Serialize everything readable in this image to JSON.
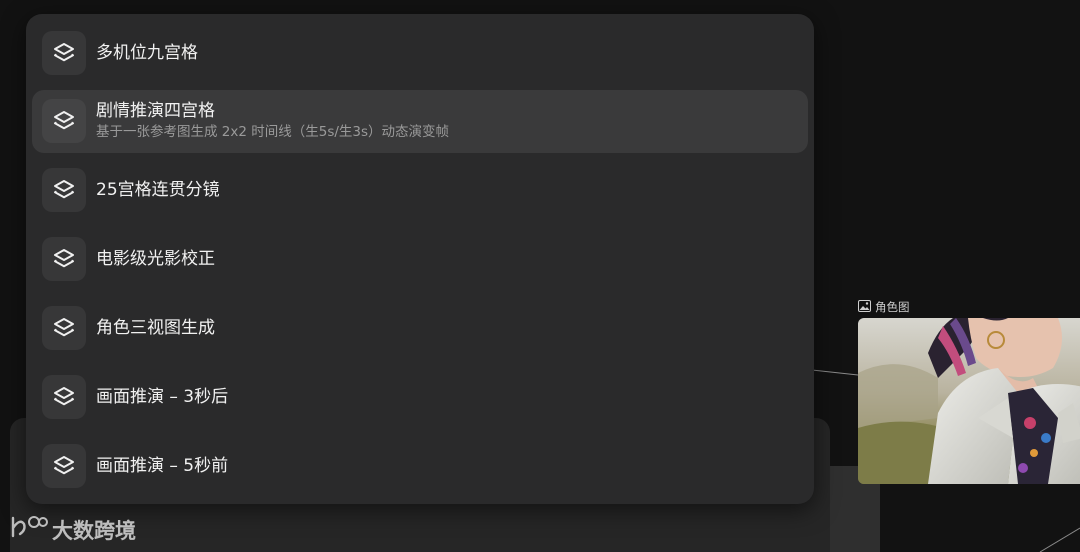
{
  "menu": {
    "items": [
      {
        "title": "多机位九宫格",
        "description": "",
        "icon": "layers-icon"
      },
      {
        "title": "剧情推演四宫格",
        "description": "基于一张参考图生成 2x2 时间线（生5s/生3s）动态演变帧",
        "icon": "layers-icon",
        "active": true
      },
      {
        "title": "25宫格连贯分镜",
        "description": "",
        "icon": "layers-icon"
      },
      {
        "title": "电影级光影校正",
        "description": "",
        "icon": "layers-icon"
      },
      {
        "title": "角色三视图生成",
        "description": "",
        "icon": "layers-icon"
      },
      {
        "title": "画面推演 – 3秒后",
        "description": "",
        "icon": "layers-icon"
      },
      {
        "title": "画面推演 – 5秒前",
        "description": "",
        "icon": "layers-icon"
      }
    ]
  },
  "node": {
    "label": "角色图",
    "label_icon": "image-icon"
  },
  "watermark": {
    "text": "大数跨境"
  }
}
